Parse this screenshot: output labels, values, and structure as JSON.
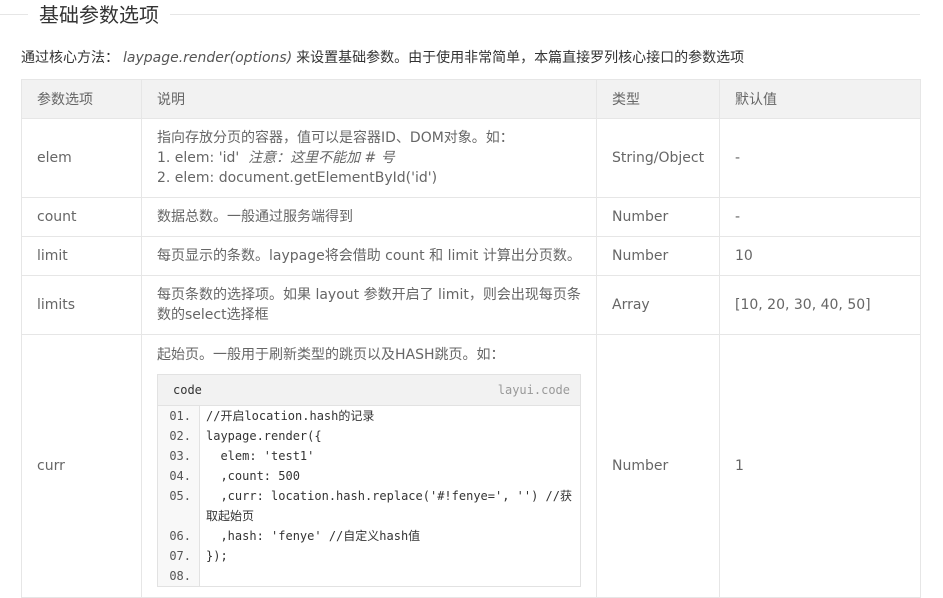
{
  "section_title": "基础参数选项",
  "intro": {
    "prefix": "通过核心方法：",
    "method": "laypage.render(options)",
    "suffix": "来设置基础参数。由于使用非常简单，本篇直接罗列核心接口的参数选项"
  },
  "table": {
    "headers": [
      "参数选项",
      "说明",
      "类型",
      "默认值"
    ],
    "rows": [
      {
        "name": "elem",
        "desc_lines": [
          "指向存放分页的容器，值可以是容器ID、DOM对象。如：",
          "1. elem: 'id'",
          "2. elem: document.getElementById('id')"
        ],
        "desc_note": "注意：这里不能加 # 号",
        "type": "String/Object",
        "default": "-"
      },
      {
        "name": "count",
        "desc": "数据总数。一般通过服务端得到",
        "type": "Number",
        "default": "-"
      },
      {
        "name": "limit",
        "desc": "每页显示的条数。laypage将会借助 count 和 limit 计算出分页数。",
        "type": "Number",
        "default": "10"
      },
      {
        "name": "limits",
        "desc": "每页条数的选择项。如果 layout 参数开启了 limit，则会出现每页条数的select选择框",
        "type": "Array",
        "default": "[10, 20, 30, 40, 50]"
      },
      {
        "name": "curr",
        "desc": "起始页。一般用于刷新类型的跳页以及HASH跳页。如：",
        "type": "Number",
        "default": "1",
        "code": {
          "label": "code",
          "brand": "layui.code",
          "lines": [
            {
              "num": "01.",
              "text": "//开启location.hash的记录"
            },
            {
              "num": "02.",
              "text": "laypage.render({"
            },
            {
              "num": "03.",
              "text": "  elem: 'test1'"
            },
            {
              "num": "04.",
              "text": "  ,count: 500"
            },
            {
              "num": "05.",
              "text": "  ,curr: location.hash.replace('#!fenye=', '') //获取起始页"
            },
            {
              "num": "06.",
              "text": "  ,hash: 'fenye' //自定义hash值"
            },
            {
              "num": "07.",
              "text": "});"
            },
            {
              "num": "08.",
              "text": ""
            }
          ]
        }
      }
    ]
  }
}
